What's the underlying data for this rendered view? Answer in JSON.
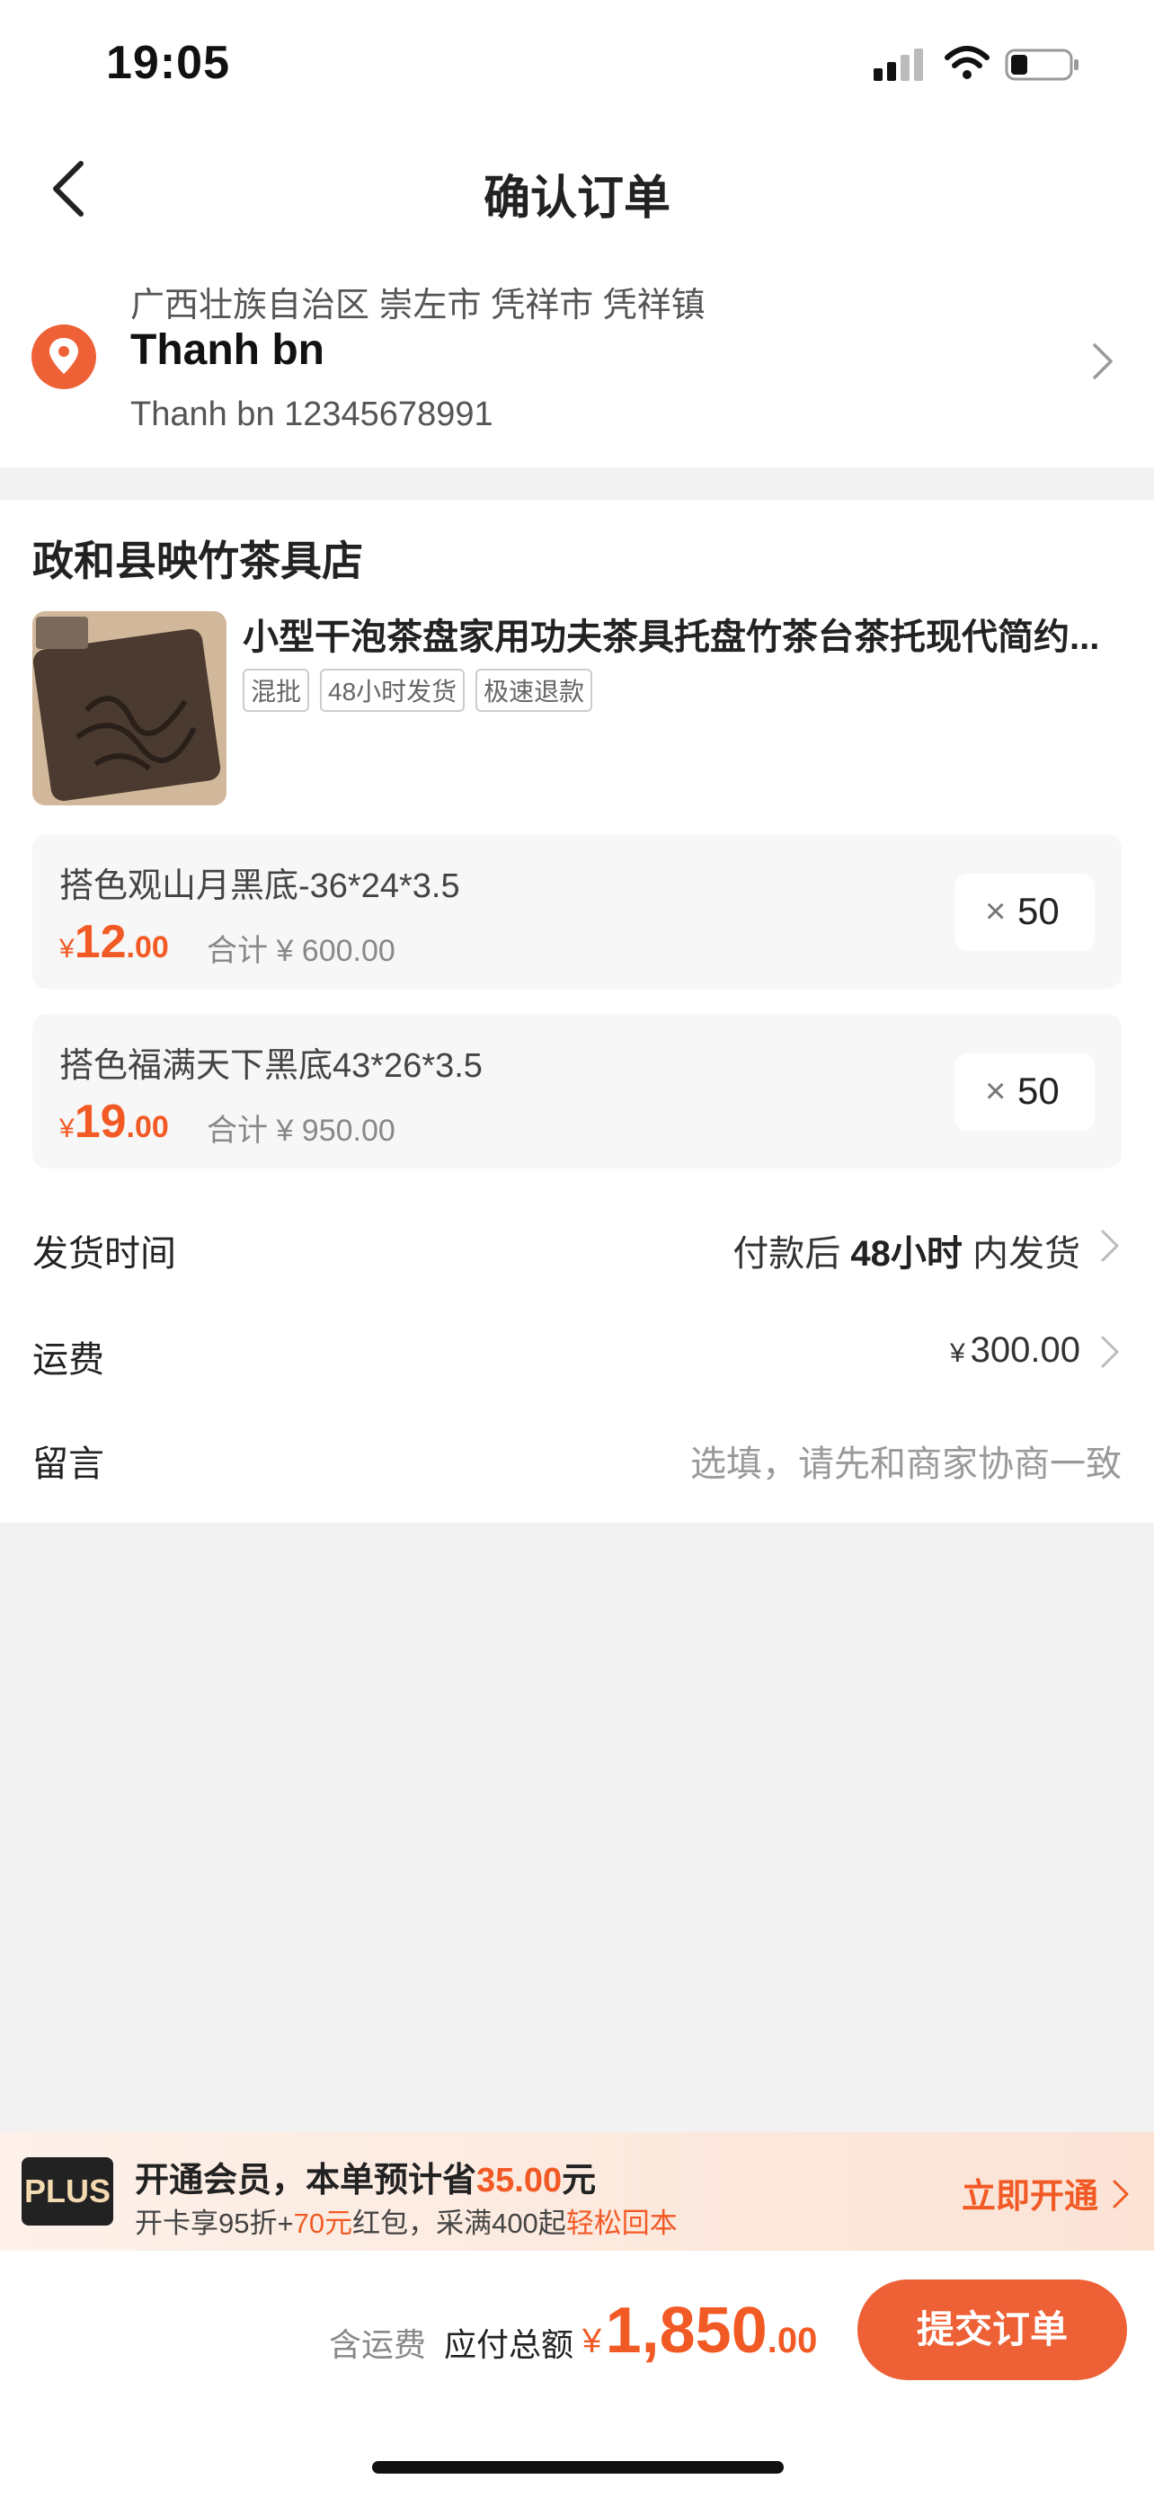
{
  "status_bar": {
    "time": "19:05"
  },
  "header": {
    "title": "确认订单"
  },
  "address": {
    "region": "广西壮族自治区 崇左市 凭祥市 凭祥镇",
    "name": "Thanh bn",
    "contact": "Thanh bn  12345678991"
  },
  "store": {
    "name": "政和县映竹茶具店",
    "product": {
      "title": "小型干泡茶盘家用功夫茶具托盘竹茶台茶托现代简约...",
      "tags": [
        "混批",
        "48小时发货",
        "极速退款"
      ]
    },
    "variants": [
      {
        "name": "搭色观山月黑底-36*24*3.5",
        "currency": "¥",
        "price_int": "12",
        "price_dec": ".00",
        "subtotal": "合计 ¥ 600.00",
        "qty_prefix": "×",
        "qty": "50"
      },
      {
        "name": "搭色福满天下黑底43*26*3.5",
        "currency": "¥",
        "price_int": "19",
        "price_dec": ".00",
        "subtotal": "合计 ¥ 950.00",
        "qty_prefix": "×",
        "qty": "50"
      }
    ]
  },
  "rows": {
    "delivery_label": "发货时间",
    "delivery_prefix": "付款后 ",
    "delivery_bold": "48小时",
    "delivery_suffix": " 内发货",
    "shipping_label": "运费",
    "shipping_currency": "¥",
    "shipping_value": "300.00",
    "message_label": "留言",
    "message_placeholder": "选填，请先和商家协商一致"
  },
  "plus": {
    "logo": "PLUS",
    "line1_a": "开通会员，本单预计省",
    "line1_amount": "35.00",
    "line1_b": "元",
    "line2_a": "开卡享95折+",
    "line2_amount": "70元",
    "line2_b": "红包，采满400起",
    "line2_c": "轻松回本",
    "cta": "立即开通"
  },
  "footer": {
    "shipping_note": "含运费",
    "total_label": "应付总额",
    "currency": "¥",
    "total_int": "1,850",
    "total_dec": ".00",
    "submit_label": "提交订单"
  },
  "colors": {
    "accent": "#f25a25",
    "submit": "#ee6035",
    "pin": "#ee6035"
  }
}
